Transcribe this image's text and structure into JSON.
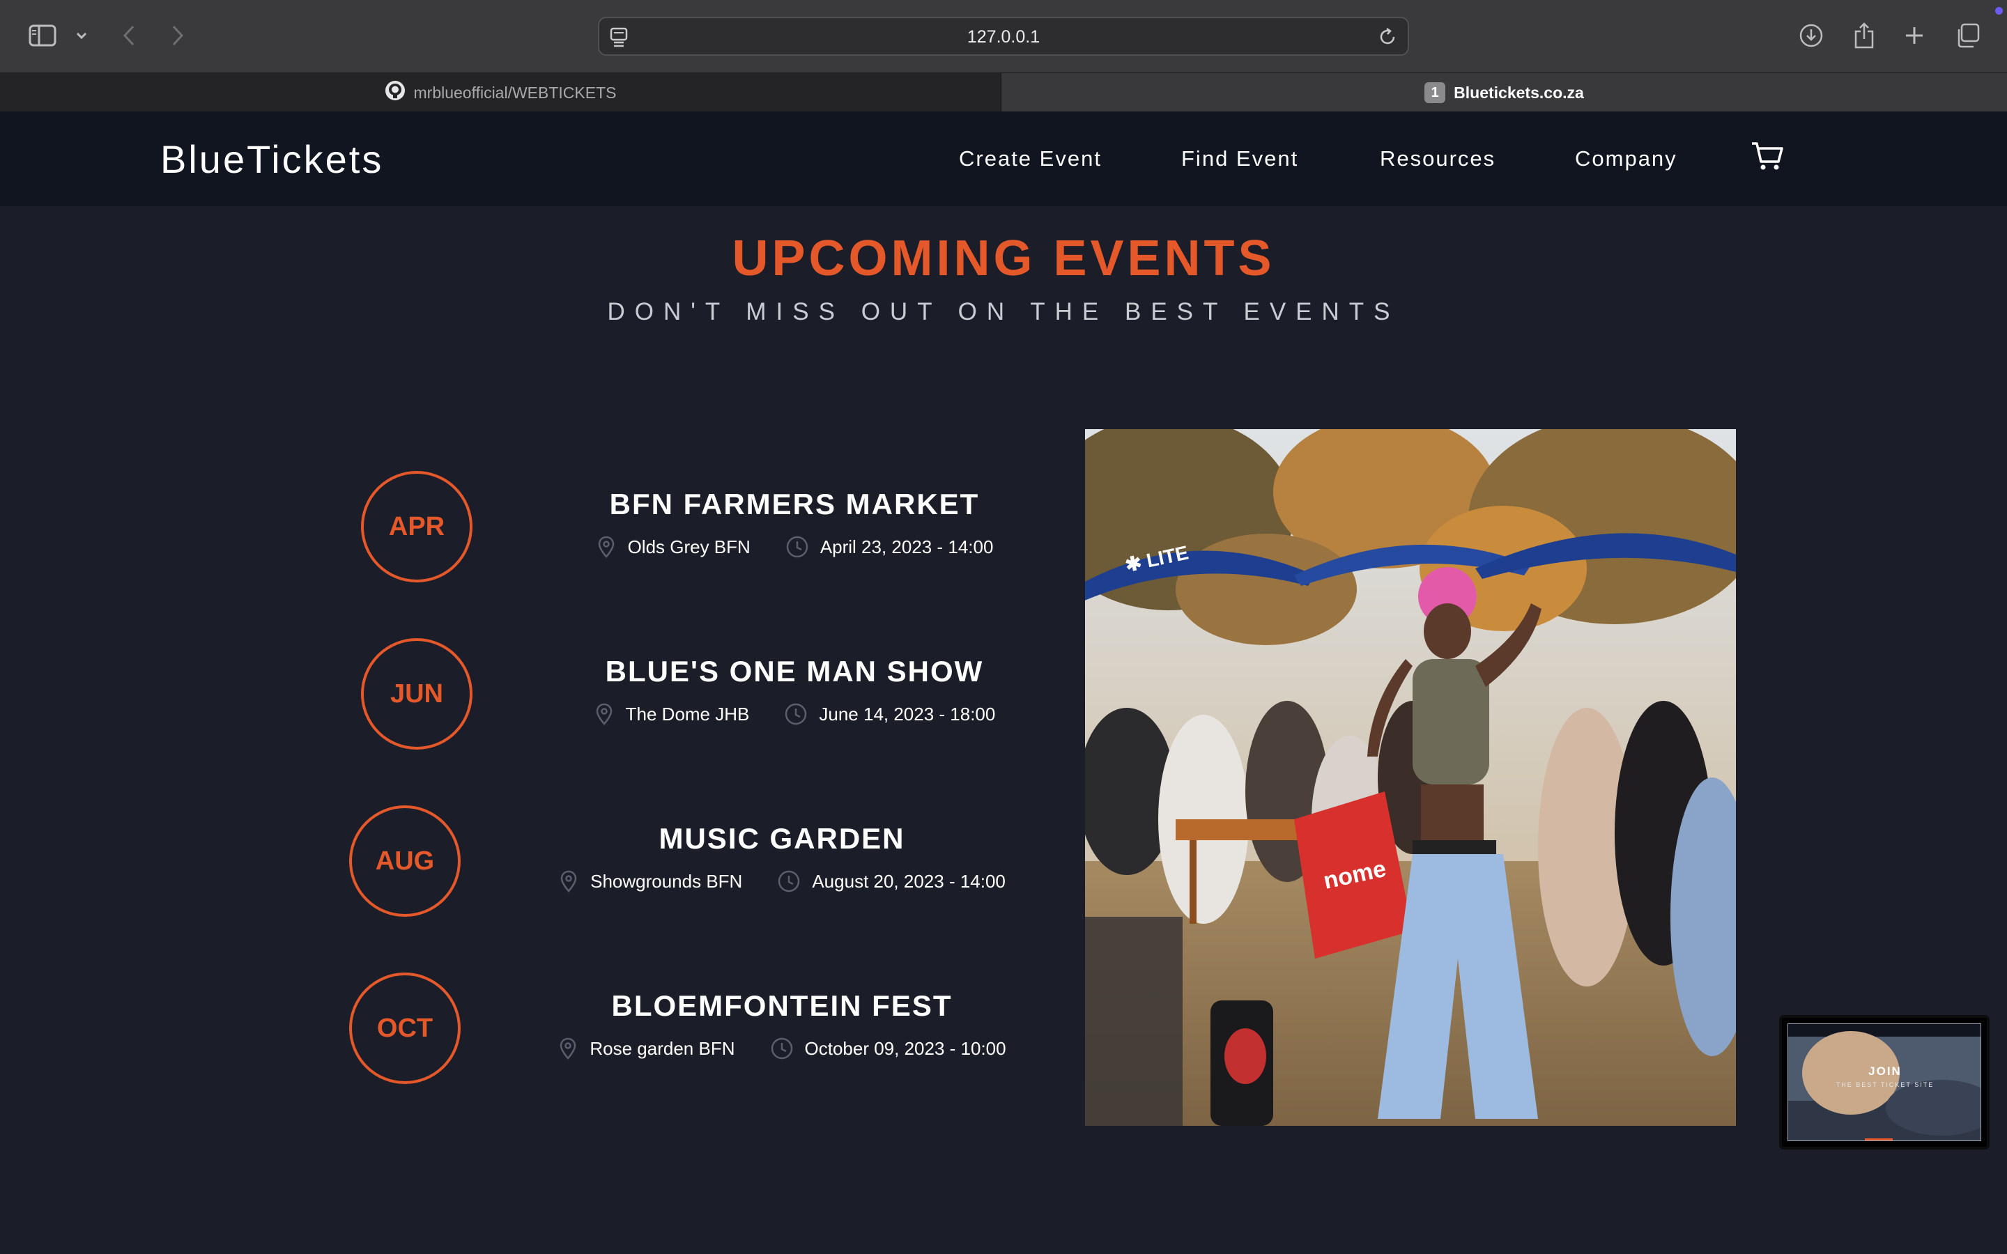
{
  "browser": {
    "url": "127.0.0.1",
    "tabs": [
      {
        "label": "mrblueofficial/WEBTICKETS",
        "icon": "github-icon",
        "active": false
      },
      {
        "label": "Bluetickets.co.za",
        "badge": "1",
        "active": true
      }
    ]
  },
  "nav": {
    "brand": "BlueTickets",
    "links": [
      "Create Event",
      "Find Event",
      "Resources",
      "Company"
    ],
    "cart_icon": "cart-icon"
  },
  "section": {
    "title": "UPCOMING EVENTS",
    "subtitle": "DON'T MISS OUT ON THE BEST EVENTS"
  },
  "events": [
    {
      "month": "APR",
      "title": "BFN FARMERS MARKET",
      "venue": "Olds Grey BFN",
      "datetime": "April 23, 2023 - 14:00"
    },
    {
      "month": "JUN",
      "title": "BLUE'S ONE MAN SHOW",
      "venue": "The Dome JHB",
      "datetime": "June 14, 2023 - 18:00"
    },
    {
      "month": "AUG",
      "title": "MUSIC GARDEN",
      "venue": "Showgrounds BFN",
      "datetime": "August 20, 2023 - 14:00"
    },
    {
      "month": "OCT",
      "title": "BLOEMFONTEIN FEST",
      "venue": "Rose garden BFN",
      "datetime": "October 09, 2023 - 10:00"
    }
  ],
  "preview": {
    "join": "JOIN",
    "subtitle": "THE BEST TICKET SITE"
  },
  "colors": {
    "accent": "#e5582a",
    "page_bg": "#1b1e28",
    "nav_bg": "#111520"
  }
}
